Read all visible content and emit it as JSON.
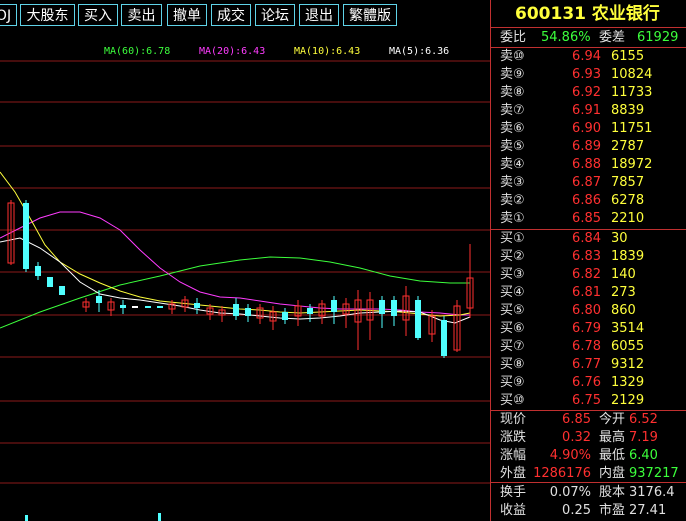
{
  "toolbar": {
    "buttons": [
      "OJ",
      "大股东",
      "买入",
      "卖出",
      "撤单",
      "成交",
      "论坛",
      "退出",
      "繁體版"
    ]
  },
  "chart": {
    "ma_legend": {
      "ma60": "MA(60):6.78",
      "ma20": "MA(20):6.43",
      "ma10": "MA(10):6.43",
      "ma5": "MA(5):6.36"
    },
    "colors": {
      "up": "#ff3030",
      "down": "#50ffff",
      "ma5": "#ffffff",
      "ma10": "#ffff3c",
      "ma20": "#ff3cff",
      "ma60": "#3cff3c",
      "grid": "#8b1a1a"
    }
  },
  "quote": {
    "code": "600131",
    "name": "农业银行",
    "weibi_label": "委比",
    "weibi_value": "54.86%",
    "weicha_label": "委差",
    "weicha_value": "61929",
    "sell": [
      {
        "label": "卖⑩",
        "price": "6.94",
        "vol": "6155"
      },
      {
        "label": "卖⑨",
        "price": "6.93",
        "vol": "10824"
      },
      {
        "label": "卖⑧",
        "price": "6.92",
        "vol": "11733"
      },
      {
        "label": "卖⑦",
        "price": "6.91",
        "vol": "8839"
      },
      {
        "label": "卖⑥",
        "price": "6.90",
        "vol": "11751"
      },
      {
        "label": "卖⑤",
        "price": "6.89",
        "vol": "2787"
      },
      {
        "label": "卖④",
        "price": "6.88",
        "vol": "18972"
      },
      {
        "label": "卖③",
        "price": "6.87",
        "vol": "7857"
      },
      {
        "label": "卖②",
        "price": "6.86",
        "vol": "6278"
      },
      {
        "label": "卖①",
        "price": "6.85",
        "vol": "2210"
      }
    ],
    "buy": [
      {
        "label": "买①",
        "price": "6.84",
        "vol": "30"
      },
      {
        "label": "买②",
        "price": "6.83",
        "vol": "1839"
      },
      {
        "label": "买③",
        "price": "6.82",
        "vol": "140"
      },
      {
        "label": "买④",
        "price": "6.81",
        "vol": "273"
      },
      {
        "label": "买⑤",
        "price": "6.80",
        "vol": "860"
      },
      {
        "label": "买⑥",
        "price": "6.79",
        "vol": "3514"
      },
      {
        "label": "买⑦",
        "price": "6.78",
        "vol": "6055"
      },
      {
        "label": "买⑧",
        "price": "6.77",
        "vol": "9312"
      },
      {
        "label": "买⑨",
        "price": "6.76",
        "vol": "1329"
      },
      {
        "label": "买⑩",
        "price": "6.75",
        "vol": "2129"
      }
    ],
    "stats": [
      {
        "l1": "现价",
        "v1": "6.85",
        "c1": "#ff3030",
        "l2": "今开",
        "v2": "6.52",
        "c2": "#ff3030"
      },
      {
        "l1": "涨跌",
        "v1": "0.32",
        "c1": "#ff3030",
        "l2": "最高",
        "v2": "7.19",
        "c2": "#ff3030"
      },
      {
        "l1": "涨幅",
        "v1": "4.90%",
        "c1": "#ff3030",
        "l2": "最低",
        "v2": "6.40",
        "c2": "#3cff3c"
      },
      {
        "l1": "外盘",
        "v1": "1286176",
        "c1": "#ff3030",
        "l2": "内盘",
        "v2": "937217",
        "c2": "#3cff3c"
      },
      {
        "l1": "换手",
        "v1": "0.07%",
        "c1": "#e0e0e0",
        "l2": "股本",
        "v2": "3176.4",
        "c2": "#e0e0e0"
      },
      {
        "l1": "收益",
        "v1": "0.25",
        "c1": "#e0e0e0",
        "l2": "市盈",
        "v2": "27.41",
        "c2": "#e0e0e0"
      }
    ]
  }
}
